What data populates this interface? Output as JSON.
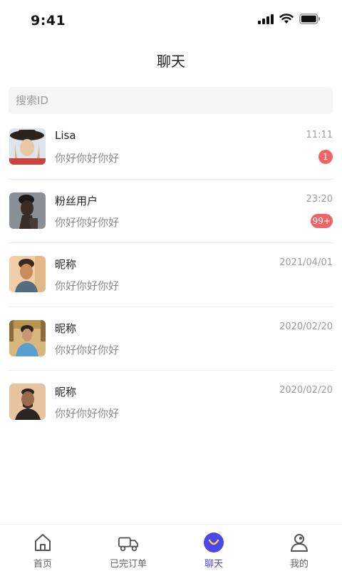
{
  "status_bar": {
    "time": "9:41"
  },
  "header": {
    "title": "聊天"
  },
  "search": {
    "placeholder": "搜索ID",
    "value": ""
  },
  "chats": [
    {
      "name": "Lisa",
      "message": "你好你好你好",
      "time": "11:11",
      "badge": "1",
      "avatar_colors": [
        "#e9c7a4",
        "#c9423d",
        "#2a2420"
      ]
    },
    {
      "name": "粉丝用户",
      "message": "你好你好你好",
      "time": "23:20",
      "badge": "99+",
      "avatar_colors": [
        "#7a7e86",
        "#3a2c26",
        "#c9c9cb"
      ]
    },
    {
      "name": "昵称",
      "message": "你好你好你好",
      "time": "2021/04/01",
      "badge": "",
      "avatar_colors": [
        "#c98d5c",
        "#3c2a20",
        "#f0cfa8"
      ]
    },
    {
      "name": "昵称",
      "message": "你好你好你好",
      "time": "2020/02/20",
      "badge": "",
      "avatar_colors": [
        "#d9b67e",
        "#5aa0cf",
        "#2d2520"
      ]
    },
    {
      "name": "昵称",
      "message": "你好你好你好",
      "time": "2020/02/20",
      "badge": "",
      "avatar_colors": [
        "#e7c3a0",
        "#5b3a2a",
        "#2b2424"
      ]
    }
  ],
  "tabs": [
    {
      "label": "首页",
      "icon": "home-icon",
      "active": false
    },
    {
      "label": "已完订单",
      "icon": "truck-icon",
      "active": false
    },
    {
      "label": "聊天",
      "icon": "chat-smile-icon",
      "active": true
    },
    {
      "label": "我的",
      "icon": "user-icon",
      "active": false
    }
  ],
  "colors": {
    "accent": "#4c47e6",
    "badge": "#f06466",
    "muted_text": "#8a8a8e",
    "search_bg": "#f4f5f7"
  }
}
